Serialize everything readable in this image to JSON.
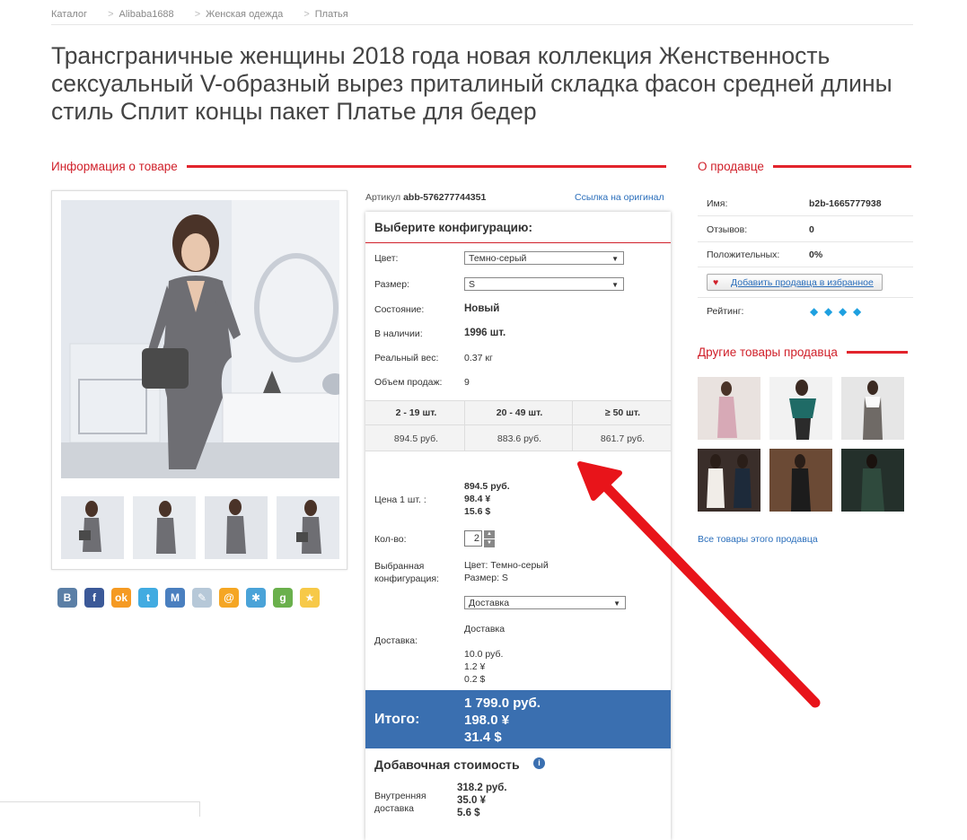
{
  "breadcrumb": [
    "Каталог",
    "Alibaba1688",
    "Женская одежда",
    "Платья"
  ],
  "title": "Трансграничные женщины 2018 года новая коллекция Женственность сексуальный V-образный вырез приталиный складка фасон средней длины стиль Сплит концы пакет Платье для бедер",
  "sections": {
    "product_info": "Информация о товаре",
    "seller": "О продавце",
    "other_goods": "Другие товары продавца"
  },
  "article": {
    "label": "Артикул",
    "value": "abb-576277744351"
  },
  "original_link": "Ссылка на оригинал",
  "config": {
    "title": "Выберите конфигурацию:",
    "color_label": "Цвет:",
    "color_value": "Темно-серый",
    "size_label": "Размер:",
    "size_value": "S",
    "condition_label": "Состояние:",
    "condition_value": "Новый",
    "stock_label": "В наличии:",
    "stock_value": "1996 шт.",
    "weight_label": "Реальный вес:",
    "weight_value": "0.37 кг",
    "sales_label": "Объем продаж:",
    "sales_value": "9",
    "tiers": [
      {
        "range": "2 - 19 шт.",
        "price": "894.5 руб."
      },
      {
        "range": "20 - 49 шт.",
        "price": "883.6 руб."
      },
      {
        "range": "≥ 50 шт.",
        "price": "861.7 руб."
      }
    ],
    "unit_price_label": "Цена 1 шт. :",
    "unit_price": [
      "894.5 руб.",
      "98.4 ¥",
      "15.6 $"
    ],
    "qty_label": "Кол-во:",
    "qty_value": "2",
    "selected_label": "Выбранная конфигурация:",
    "selected_color": "Цвет: Темно-серый",
    "selected_size": "Размер: S",
    "delivery_select": "Доставка",
    "delivery_label": "Доставка:",
    "delivery_name": "Доставка",
    "delivery_price": [
      "10.0 руб.",
      "1.2 ¥",
      "0.2 $"
    ],
    "total_label": "Итого:",
    "total": [
      "1 799.0 руб.",
      "198.0 ¥",
      "31.4 $"
    ],
    "added_value_title": "Добавочная стоимость",
    "inner_delivery_label": "Внутренняя доставка",
    "inner_delivery": [
      "318.2 руб.",
      "35.0 ¥",
      "5.6 $"
    ]
  },
  "seller": {
    "name_label": "Имя:",
    "name_value": "b2b-1665777938",
    "reviews_label": "Отзывов:",
    "reviews_value": "0",
    "positive_label": "Положительных:",
    "positive_value": "0%",
    "add_fav": "Добавить продавца в избранное",
    "rating_label": "Рейтинг:",
    "rating_gems": 4
  },
  "all_goods_link": "Все товары этого продавца",
  "social": [
    {
      "icon": "vk-icon",
      "glyph": "В",
      "color": "#5b7fa6"
    },
    {
      "icon": "facebook-icon",
      "glyph": "f",
      "color": "#3b5998"
    },
    {
      "icon": "odnoklassniki-icon",
      "glyph": "ok",
      "color": "#f59a23"
    },
    {
      "icon": "twitter-icon",
      "glyph": "t",
      "color": "#41abe1"
    },
    {
      "icon": "moimir-icon",
      "glyph": "М",
      "color": "#4a7fbf"
    },
    {
      "icon": "livejournal-icon",
      "glyph": "✎",
      "color": "#b6c8d8"
    },
    {
      "icon": "mailru-icon",
      "glyph": "@",
      "color": "#f5a623"
    },
    {
      "icon": "settings-icon",
      "glyph": "✱",
      "color": "#4aa3d8"
    },
    {
      "icon": "google-plus-icon",
      "glyph": "g",
      "color": "#6ab04c"
    },
    {
      "icon": "favorites-star-icon",
      "glyph": "★",
      "color": "#f7c948"
    }
  ],
  "colors": {
    "accent_red": "#e2242c",
    "total_blue": "#3a6fb0",
    "link_blue": "#2a6ebb"
  }
}
